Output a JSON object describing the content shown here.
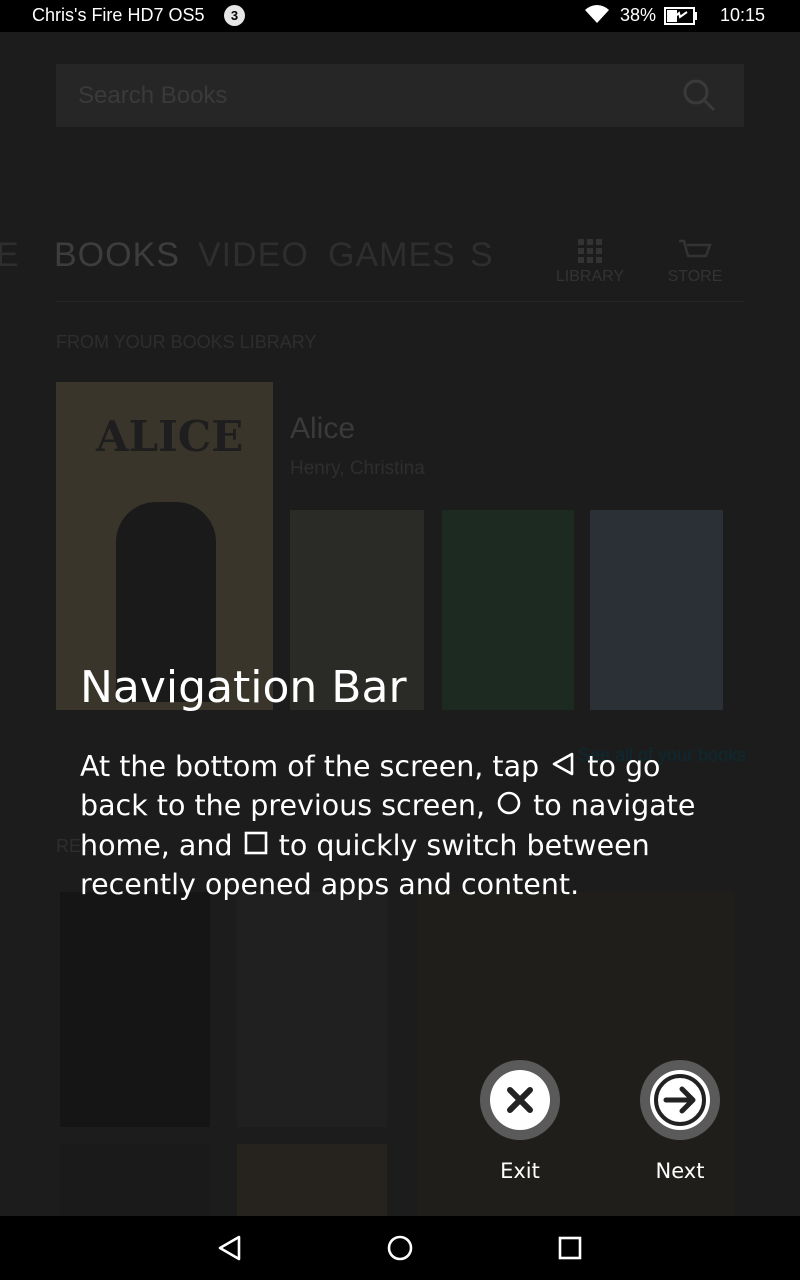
{
  "status_bar": {
    "device_name": "Chris's Fire HD7 OS5",
    "notification_count": "3",
    "battery_percent": "38%",
    "time": "10:15"
  },
  "background": {
    "search_placeholder": "Search Books",
    "tabs": [
      "E",
      "BOOKS",
      "VIDEO",
      "GAMES",
      "S"
    ],
    "library_label": "LIBRARY",
    "store_label": "STORE",
    "section_books_library": "FROM YOUR BOOKS LIBRARY",
    "featured_title": "Alice",
    "featured_author": "Henry, Christina",
    "hero_cover_text": "ALICE",
    "see_all_link": "See all of your books",
    "section_recommended": "RE"
  },
  "tutorial": {
    "title": "Navigation Bar",
    "body_part1": "At the bottom of the screen, tap",
    "body_part2": "to go back to the previous screen,",
    "body_part3": "to navigate home, and",
    "body_part4": "to quickly switch between recently opened apps and content.",
    "exit_label": "Exit",
    "next_label": "Next"
  },
  "colors": {
    "overlay_text": "#ffffff",
    "button_ring": "#5a5a5a",
    "button_fill": "#ffffff",
    "icon_dark": "#222222"
  },
  "icons": {
    "back": "back-triangle-icon",
    "home": "home-circle-icon",
    "recents": "recents-square-icon",
    "exit": "close-icon",
    "next": "arrow-right-icon",
    "wifi": "wifi-icon",
    "battery": "battery-charging-icon",
    "search": "search-icon"
  }
}
